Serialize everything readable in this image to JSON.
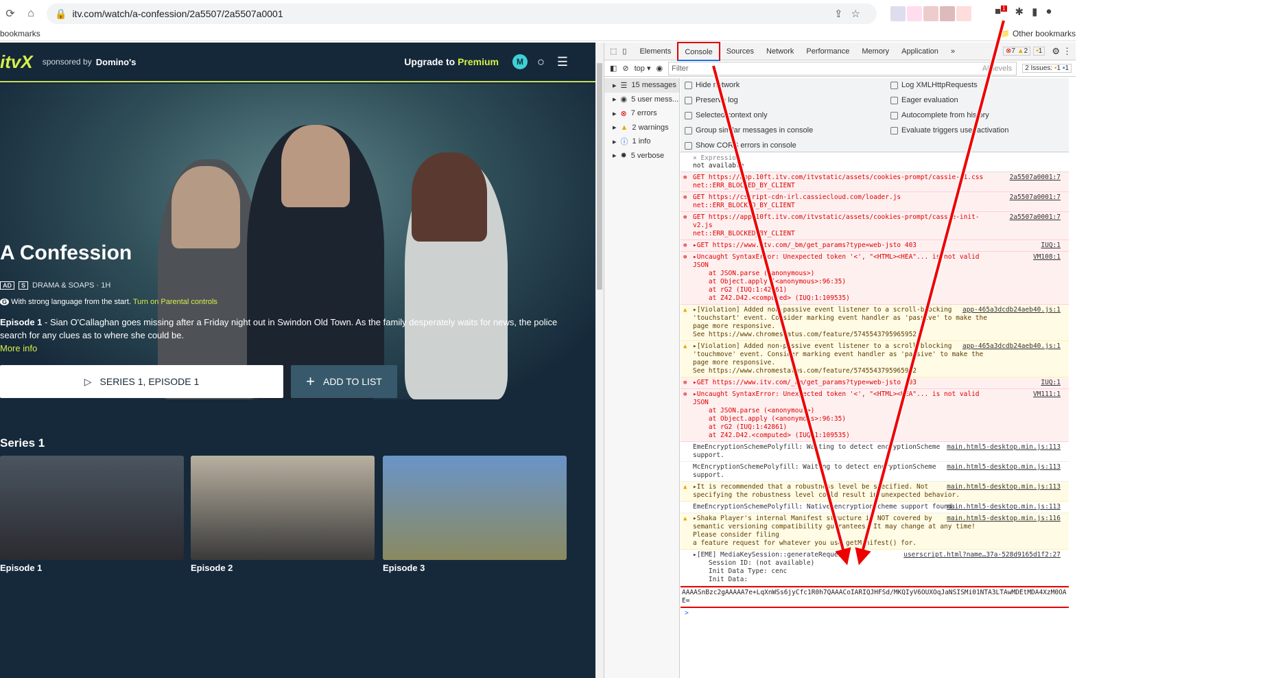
{
  "browser": {
    "url": "itv.com/watch/a-confession/2a5507/2a5507a0001",
    "bookmarks_label": "bookmarks",
    "other_bookmarks": "Other bookmarks",
    "ext_badge": "1"
  },
  "page": {
    "logo": "itvX",
    "sponsored": "sponsored by",
    "sponsor": "Domino's",
    "upgrade": "Upgrade to",
    "premium": "Premium",
    "avatar": "M",
    "title": "A Confession",
    "badge_ad": "AD",
    "badge_s": "S",
    "genre": "DRAMA & SOAPS · 1H",
    "guidance_badge": "G",
    "guidance": "With strong language from the start.",
    "parental": "Turn on Parental controls",
    "ep_label": "Episode 1",
    "description": " - Sian O'Callaghan goes missing after a Friday night out in Swindon Old Town. As the family desperately waits for news, the police search for any clues as to where she could be.",
    "more": "More info",
    "play": "SERIES 1, EPISODE 1",
    "add": "ADD TO LIST",
    "series": "Series 1",
    "episodes": [
      "Episode 1",
      "Episode 2",
      "Episode 3"
    ]
  },
  "devtools": {
    "tabs": [
      "Elements",
      "Console",
      "Sources",
      "Network",
      "Performance",
      "Memory",
      "Application"
    ],
    "more": "»",
    "errors": "7",
    "warnings": "2",
    "issues_badge": "1",
    "context": "top",
    "filter": "Filter",
    "levels": "All levels",
    "issues": "2 Issues:",
    "issues_e": "1",
    "issues_i": "1",
    "sidebar": [
      "15 messages",
      "5 user mess...",
      "7 errors",
      "2 warnings",
      "1 info",
      "5 verbose"
    ],
    "settings_left": [
      "Hide network",
      "Preserve log",
      "Selected context only",
      "Group similar messages in console",
      "Show CORS errors in console"
    ],
    "settings_right": [
      "Log XMLHttpRequests",
      "Eager evaluation",
      "Autocomplete from history",
      "Evaluate triggers user activation"
    ],
    "expression": "Expression",
    "expression_value": "not available",
    "messages": [
      {
        "type": "err",
        "text": "GET https://app.10ft.itv.com/itvstatic/assets/cookies-prompt/cassie-v1.css\nnet::ERR_BLOCKED_BY_CLIENT",
        "src": "2a5507a0001:7"
      },
      {
        "type": "err",
        "text": "GET https://cscript-cdn-irl.cassiecloud.com/loader.js\nnet::ERR_BLOCKED_BY_CLIENT",
        "src": "2a5507a0001:7"
      },
      {
        "type": "err",
        "text": "GET https://app.10ft.itv.com/itvstatic/assets/cookies-prompt/cassie-init-v2.js\nnet::ERR_BLOCKED_BY_CLIENT",
        "src": "2a5507a0001:7"
      },
      {
        "type": "err",
        "text": "▸GET https://www.itv.com/_bm/get_params?type=web-jsto 403",
        "src": "IUQ:1"
      },
      {
        "type": "err",
        "text": "▸Uncaught SyntaxError: Unexpected token '<', \"<HTML><HEA\"... is not valid JSON\n    at JSON.parse (<anonymous>)\n    at Object.apply (<anonymous>:96:35)\n    at rG2 (IUQ:1:42861)\n    at Z42.D42.<computed> (IUQ:1:109535)",
        "src": "VM108:1"
      },
      {
        "type": "wrn",
        "text": "▸[Violation] Added non-passive event listener to a scroll-blocking\n'touchstart' event. Consider marking event handler as 'passive' to make the page more responsive.\nSee https://www.chromestatus.com/feature/5745543795965952",
        "src": "app-465a3dcdb24aeb40.js:1"
      },
      {
        "type": "wrn",
        "text": "▸[Violation] Added non-passive event listener to a scroll-blocking\n'touchmove' event. Consider marking event handler as 'passive' to make the page more responsive.\nSee https://www.chromestatus.com/feature/5745543795965952",
        "src": "app-465a3dcdb24aeb40.js:1"
      },
      {
        "type": "err",
        "text": "▸GET https://www.itv.com/_bm/get_params?type=web-jsto 403",
        "src": "IUQ:1"
      },
      {
        "type": "err",
        "text": "▸Uncaught SyntaxError: Unexpected token '<', \"<HTML><HEA\"... is not valid JSON\n    at JSON.parse (<anonymous>)\n    at Object.apply (<anonymous>:96:35)\n    at rG2 (IUQ:1:42861)\n    at Z42.D42.<computed> (IUQ:1:109535)",
        "src": "VM111:1"
      },
      {
        "type": "inf",
        "text": "EmeEncryptionSchemePolyfill: Waiting to detect encryptionScheme\nsupport.",
        "src": "main.html5-desktop.min.js:113"
      },
      {
        "type": "inf",
        "text": "McEncryptionSchemePolyfill: Waiting to detect encryptionScheme\nsupport.",
        "src": "main.html5-desktop.min.js:113"
      },
      {
        "type": "wrn",
        "text": "▸It is recommended that a robustness level be specified. Not\nspecifying the robustness level could result in unexpected behavior.",
        "src": "main.html5-desktop.min.js:113"
      },
      {
        "type": "inf",
        "text": "EmeEncryptionSchemePolyfill: Native encryptionScheme support found.",
        "src": "main.html5-desktop.min.js:113"
      },
      {
        "type": "wrn",
        "text": "▸Shaka Player's internal Manifest structure is NOT covered by\nsemantic versioning compatibility guarantees. It may change at any time!  Please consider filing\na feature request for whatever you use getManifest() for.",
        "src": "main.html5-desktop.min.js:116"
      },
      {
        "type": "inf",
        "text": "▸[EME] MediaKeySession::generateRequest\n    Session ID: (not available)\n    Init Data Type: cenc\n    Init Data:",
        "src": "userscript.html?name…37a-528d9165d1f2:27"
      }
    ],
    "init_data": "AAAASnBzc2gAAAAA7e+LqXnWSs6jyCfc1R0h7QAAACoIARIQJHFSd/MKQIyV6OUXOqJaNSISMi01NTA3LTAwMDEtMDA4XzM0OAE=",
    "prompt": ">"
  }
}
